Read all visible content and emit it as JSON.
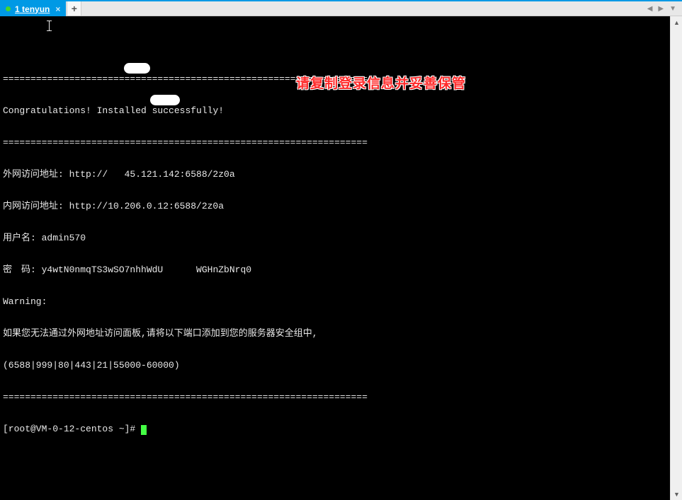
{
  "tabbar": {
    "active_tab": {
      "indicator_color": "#44d62c",
      "num": "1",
      "name": "tenyun"
    },
    "newtab_label": "+",
    "nav_left": "◀",
    "nav_right": "▶",
    "menu": "▼"
  },
  "terminal": {
    "lines": [
      "",
      "==================================================================",
      "Congratulations! Installed successfully!",
      "==================================================================",
      "外网访问地址: http://   45.121.142:6588/2z0a",
      "内网访问地址: http://10.206.0.12:6588/2z0a",
      "用户名: admin570",
      "密　码: y4wtN0nmqTS3wSO7nhhWdU      WGHnZbNrq0",
      "Warning:",
      "如果您无法通过外网地址访问面板,请将以下端口添加到您的服务器安全组中,",
      "(6588|999|80|443|21|55000-60000)",
      "=================================================================="
    ],
    "prompt": "[root@VM-0-12-centos ~]# "
  },
  "overlay": {
    "text": "请复制登录信息并妥善保管"
  },
  "scrollbar": {
    "up": "▲",
    "down": "▼"
  }
}
